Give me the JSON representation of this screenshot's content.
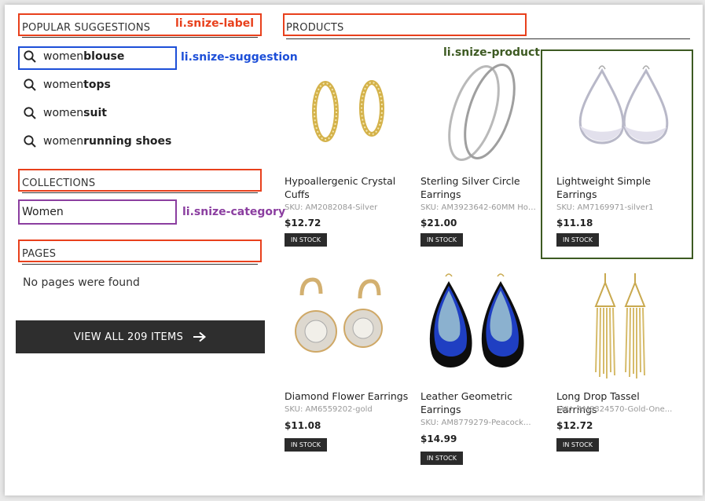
{
  "sections": {
    "popular": "POPULAR SUGGESTIONS",
    "products": "PRODUCTS",
    "collections": "COLLECTIONS",
    "pages": "PAGES"
  },
  "suggestions": [
    {
      "prefix": "women",
      "bold": "blouse"
    },
    {
      "prefix": "women",
      "bold": "tops"
    },
    {
      "prefix": "women",
      "bold": "suit"
    },
    {
      "prefix": "women",
      "bold": "running shoes"
    }
  ],
  "collection_item": "Women",
  "no_pages_text": "No pages were found",
  "view_all_label": "VIEW ALL 209 ITEMS",
  "annotations": {
    "label": "li.snize-label",
    "suggestion": "li.snize-suggestion",
    "product": "li.snize-product",
    "category": "li.snize-category"
  },
  "colors": {
    "red": "#e8401c",
    "blue": "#1d4fd8",
    "purple": "#8b3ea0",
    "green": "#3d5a22",
    "button": "#2e2e2e"
  },
  "products": [
    {
      "name": "Hypoallergenic Crystal Cuffs",
      "sku": "SKU: AM2082084-Silver",
      "price": "$12.72",
      "stock": "IN STOCK",
      "icon": "gold-hoop-earrings"
    },
    {
      "name": "Sterling Silver Circle Earrings",
      "sku": "SKU: AM3923642-60MM Hoop...",
      "price": "$21.00",
      "stock": "IN STOCK",
      "icon": "silver-hoop-earrings"
    },
    {
      "name": "Lightweight Simple Earrings",
      "sku": "SKU: AM7169971-silver1",
      "price": "$11.18",
      "stock": "IN STOCK",
      "icon": "silver-drop-earrings"
    },
    {
      "name": "Diamond Flower Earrings",
      "sku": "SKU: AM6559202-gold",
      "price": "$11.08",
      "stock": "IN STOCK",
      "icon": "flower-earrings"
    },
    {
      "name": "Leather Geometric Earrings",
      "sku": "SKU: AM8779279-Peacock...",
      "price": "$14.99",
      "stock": "IN STOCK",
      "icon": "leather-teardrop-earrings"
    },
    {
      "name": "Long Drop Tassel Earrings",
      "sku": "SKU: AM8324570-Gold-One...",
      "price": "$12.72",
      "stock": "IN STOCK",
      "icon": "tassel-earrings"
    }
  ]
}
